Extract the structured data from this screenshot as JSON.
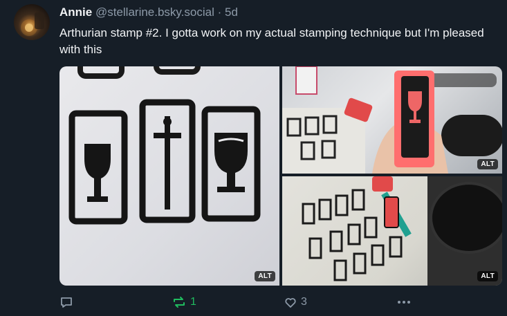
{
  "post": {
    "author_name": "Annie",
    "author_handle": "@stellarine.bsky.social",
    "separator": "·",
    "time": "5d",
    "text": "Arthurian stamp #2. I gotta work on my actual stamping technique but I'm pleased with this"
  },
  "media": {
    "alt_label": "ALT"
  },
  "actions": {
    "repost_count": "1",
    "like_count": "3"
  },
  "colors": {
    "background": "#161e27",
    "text": "#f1f3f5",
    "muted": "#8d9aa8",
    "repost_active": "#20bc5f"
  }
}
